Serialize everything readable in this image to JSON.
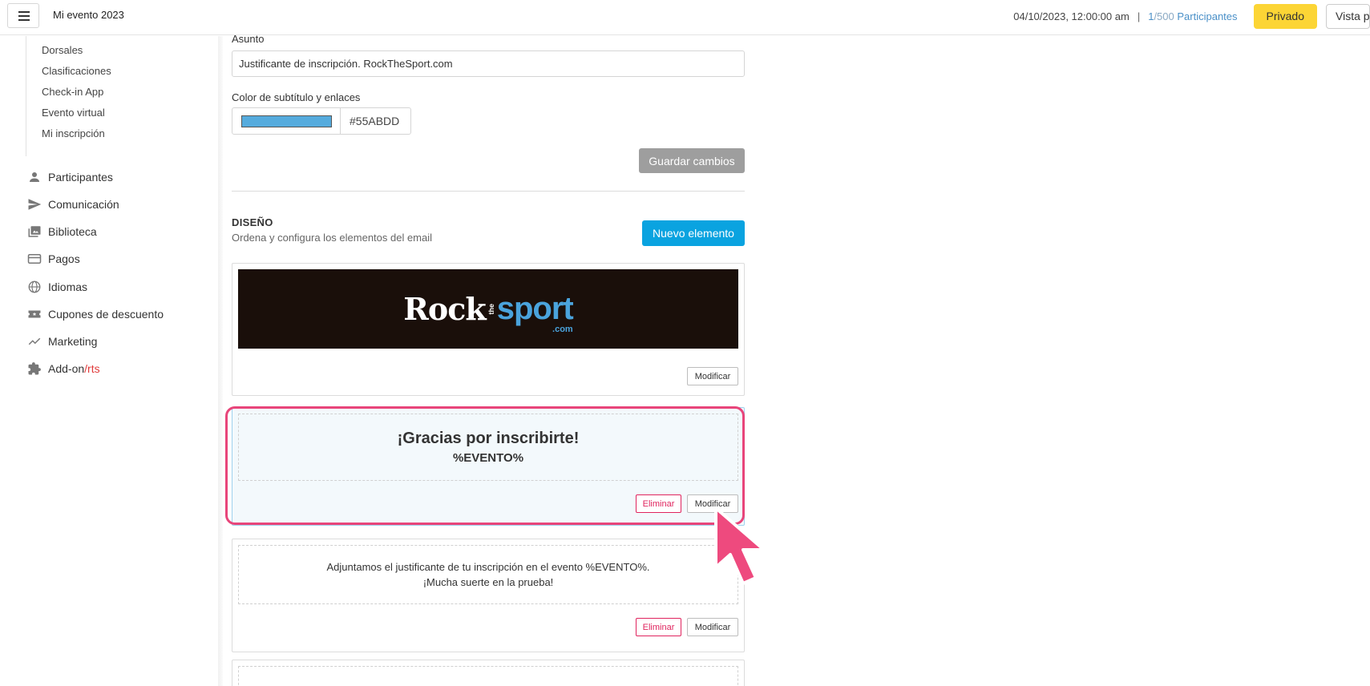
{
  "header": {
    "title": "Mi evento 2023",
    "date": "04/10/2023, 12:00:00 am",
    "separator": "|",
    "count_current": "1",
    "count_total": "/500",
    "count_label": "Participantes",
    "privado_label": "Privado",
    "vista_label": "Vista p"
  },
  "sidebar": {
    "subitems": [
      "Dorsales",
      "Clasificaciones",
      "Check-in App",
      "Evento virtual",
      "Mi inscripción"
    ],
    "items": [
      {
        "label": "Participantes",
        "icon": "person-icon"
      },
      {
        "label": "Comunicación",
        "icon": "send-icon"
      },
      {
        "label": "Biblioteca",
        "icon": "photo-library-icon"
      },
      {
        "label": "Pagos",
        "icon": "credit-card-icon"
      },
      {
        "label": "Idiomas",
        "icon": "globe-icon"
      },
      {
        "label": "Cupones de descuento",
        "icon": "coupon-icon"
      },
      {
        "label": "Marketing",
        "icon": "trending-icon"
      },
      {
        "label": "Add-on",
        "label_accent": "/rts",
        "icon": "puzzle-icon"
      }
    ]
  },
  "form": {
    "subject_label": "Asunto",
    "subject_value": "Justificante de inscripción. RockTheSport.com",
    "color_label": "Color de subtítulo y enlaces",
    "color_value": "#55ABDD",
    "save_label": "Guardar cambios"
  },
  "design": {
    "title": "DISEÑO",
    "subtitle": "Ordena y configura los elementos del email",
    "new_label": "Nuevo elemento",
    "logo": {
      "rock": "Rock",
      "the": "the",
      "sport": "sport",
      "com": ".com"
    },
    "modify_label": "Modificar",
    "delete_label": "Eliminar",
    "heading": "¡Gracias por inscribirte!",
    "heading_sub": "%EVENTO%",
    "para_line1": "Adjuntamos el justificante de tu inscripción en el evento %EVENTO%.",
    "para_line2": "¡Mucha suerte en la prueba!"
  },
  "colors": {
    "accent_blue": "#0aa3e0",
    "highlight_pink": "#e8457a",
    "privado_yellow": "#fcd535",
    "swatch": "#55ABDD"
  }
}
